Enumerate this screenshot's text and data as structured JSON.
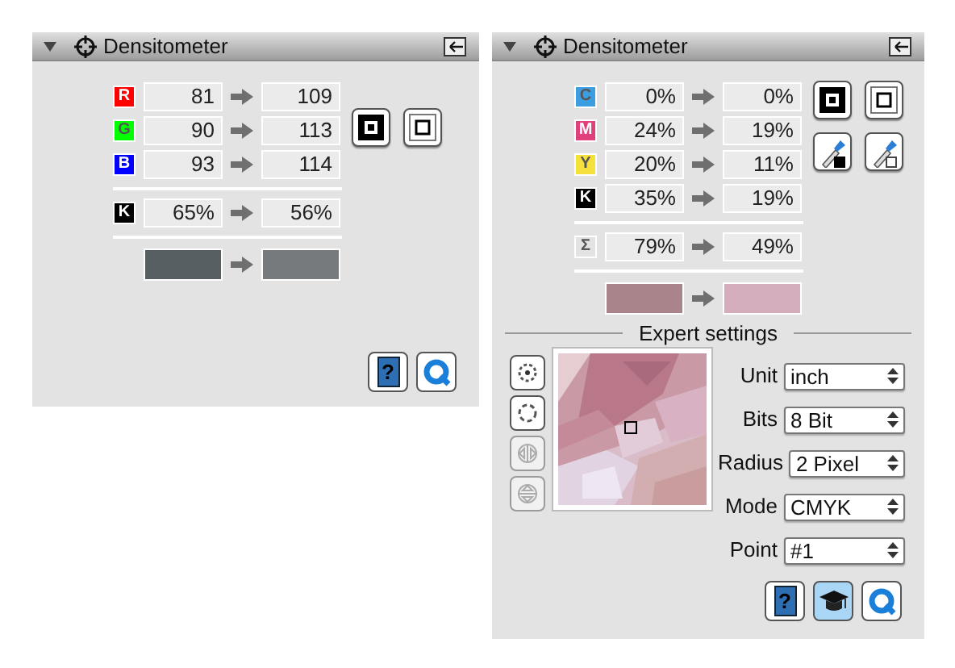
{
  "panels": [
    {
      "kind": "rgb",
      "title": "Densitometer",
      "expanded": true,
      "rows": [
        {
          "kind": "channel",
          "letter": "R",
          "color": "#ff0000",
          "before": "81",
          "after": "109"
        },
        {
          "kind": "channel",
          "letter": "G",
          "color": "#00ff00",
          "before": "90",
          "after": "113"
        },
        {
          "kind": "channel",
          "letter": "B",
          "color": "#0000ff",
          "before": "93",
          "after": "114"
        },
        {
          "kind": "rule"
        },
        {
          "kind": "channel",
          "letter": "K",
          "color": "#000000",
          "before": "65%",
          "after": "56%"
        },
        {
          "kind": "rule"
        },
        {
          "kind": "swatch",
          "before": {
            "color": "#575f62"
          },
          "after": {
            "color": "#767a7d"
          }
        }
      ],
      "tools": [
        {
          "kind": "mode-black"
        },
        {
          "kind": "mode-white"
        }
      ],
      "footer": [
        {
          "kind": "help",
          "glyph": "?",
          "selected": false
        },
        {
          "kind": "quick",
          "selected": false
        }
      ]
    },
    {
      "kind": "cmyk",
      "title": "Densitometer",
      "expanded": true,
      "rows": [
        {
          "kind": "channel",
          "letter": "C",
          "color": "#3c9ee0",
          "before": "0%",
          "after": "0%"
        },
        {
          "kind": "channel",
          "letter": "M",
          "color": "#e0407c",
          "before": "24%",
          "after": "19%"
        },
        {
          "kind": "channel",
          "letter": "Y",
          "color": "#f6e03c",
          "before": "20%",
          "after": "11%"
        },
        {
          "kind": "channel",
          "letter": "K",
          "color": "#000000",
          "before": "35%",
          "after": "19%"
        },
        {
          "kind": "rule"
        },
        {
          "kind": "channel",
          "letter": "Σ",
          "color": "#e3e3e3",
          "before": "79%",
          "after": "49%"
        },
        {
          "kind": "rule"
        },
        {
          "kind": "swatch",
          "before": {
            "color": "#a9848b"
          },
          "after": {
            "color": "#d3adbb"
          }
        }
      ],
      "tools": [
        {
          "kind": "mode-black"
        },
        {
          "kind": "mode-white"
        },
        {
          "kind": "pick-black"
        },
        {
          "kind": "pick-white"
        }
      ],
      "expert": {
        "heading": "Expert settings",
        "side_tools": [
          {
            "kind": "move",
            "disabled": false
          },
          {
            "kind": "circle",
            "disabled": false
          },
          {
            "kind": "flip-h",
            "disabled": true
          },
          {
            "kind": "flip-v",
            "disabled": true
          }
        ],
        "settings": [
          {
            "label": "Unit",
            "value": "inch"
          },
          {
            "label": "Bits",
            "value": "8 Bit"
          },
          {
            "label": "Radius",
            "value": "2 Pixel"
          },
          {
            "label": "Mode",
            "value": "CMYK"
          },
          {
            "label": "Point",
            "value": "#1"
          }
        ]
      },
      "footer": [
        {
          "kind": "help",
          "glyph": "?",
          "selected": false
        },
        {
          "kind": "learn",
          "selected": true
        },
        {
          "kind": "quick",
          "selected": false
        }
      ]
    }
  ]
}
